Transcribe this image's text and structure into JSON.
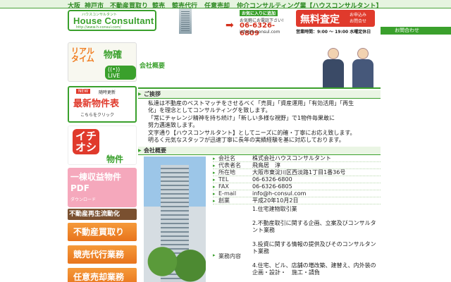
{
  "topbar": {
    "items": [
      "大阪",
      "神戸市",
      "不動産買取り",
      "競売",
      "競売代行",
      "任意売却",
      "仲介コンサルティング業【ハウスコンサルタント】"
    ]
  },
  "header": {
    "logo_small": "ハウスコンサルタント",
    "logo_main": "House Consultant",
    "logo_url": "http://www.h-consul.com/",
    "contact_tag": "お気に入りに追加",
    "phone_label": "お気軽にお電話下さい!",
    "phone": "06-6326-6809",
    "email": "info@h-consul.com",
    "assess_title": "無料査定",
    "assess_sub": "お申込み\nお問合せ",
    "hours": "営業時間：9:00 〜 19:00  水曜定休日",
    "contact_button": "お問合わせ"
  },
  "sidebar": {
    "banner1_a": "リアル\nタイム",
    "banner1_b": "物確",
    "banner1_c": "((•)) LIVE",
    "banner2_new": "NEW",
    "banner2_sub": "随時更新",
    "banner2_main": "最新物件表",
    "banner2_click": "こちらをクリック",
    "banner3_a": "イチ\nオシ",
    "banner3_b": "物件",
    "banner4_a": "一棟収益物件",
    "banner4_b": "PDF",
    "banner4_c": "ダウンロード",
    "menu": [
      "不動産再生流動化",
      "不動産買取り",
      "競売代行業務",
      "任意売却業務"
    ]
  },
  "content": {
    "title": "会社概要",
    "greeting_head": "ご挨拶",
    "greeting_lines": [
      "私達は不動産のベストマッチをさせるべく「売買」「資産運用」「有効活用」「再生",
      "化」を理念としてコンサルティングを致します。",
      "「常にチャレンジ精神を持ち続け」「新しい多様な視野」で1物件毎果敢に",
      "努力邁進致します。",
      "文字通り【ハウスコンサルタント】としてニーズに的確・丁寧にお応え致します。",
      "明るく元気なスタッフが迅速丁寧に長年の実績経験を基に対応しております。"
    ],
    "company_head": "会社概要",
    "info": [
      {
        "k": "会社名",
        "v": "株式会社ハウスコンサルタント"
      },
      {
        "k": "代表者名",
        "v": "飛鳥居　淳"
      },
      {
        "k": "所在地",
        "v": "大阪市東淀川区西淡路1丁目1番36号"
      },
      {
        "k": "TEL",
        "v": "06-6326-6800"
      },
      {
        "k": "FAX",
        "v": "06-6326-6805"
      },
      {
        "k": "E-mail",
        "v": "info@h-consul.com"
      },
      {
        "k": "創業",
        "v": "平成20年10月2日"
      }
    ],
    "biz_key": "業務内容",
    "biz": [
      "1.住宅建物取引業",
      "2.不動産取引に関する企画、立案及びコンサルタント業務",
      "3.投資に関する情報の提供及びそのコンサルタント業務",
      "4.住宅、ビル、店舗の増改築、建替え、内外装の企画・設計・　施工・請負"
    ]
  }
}
